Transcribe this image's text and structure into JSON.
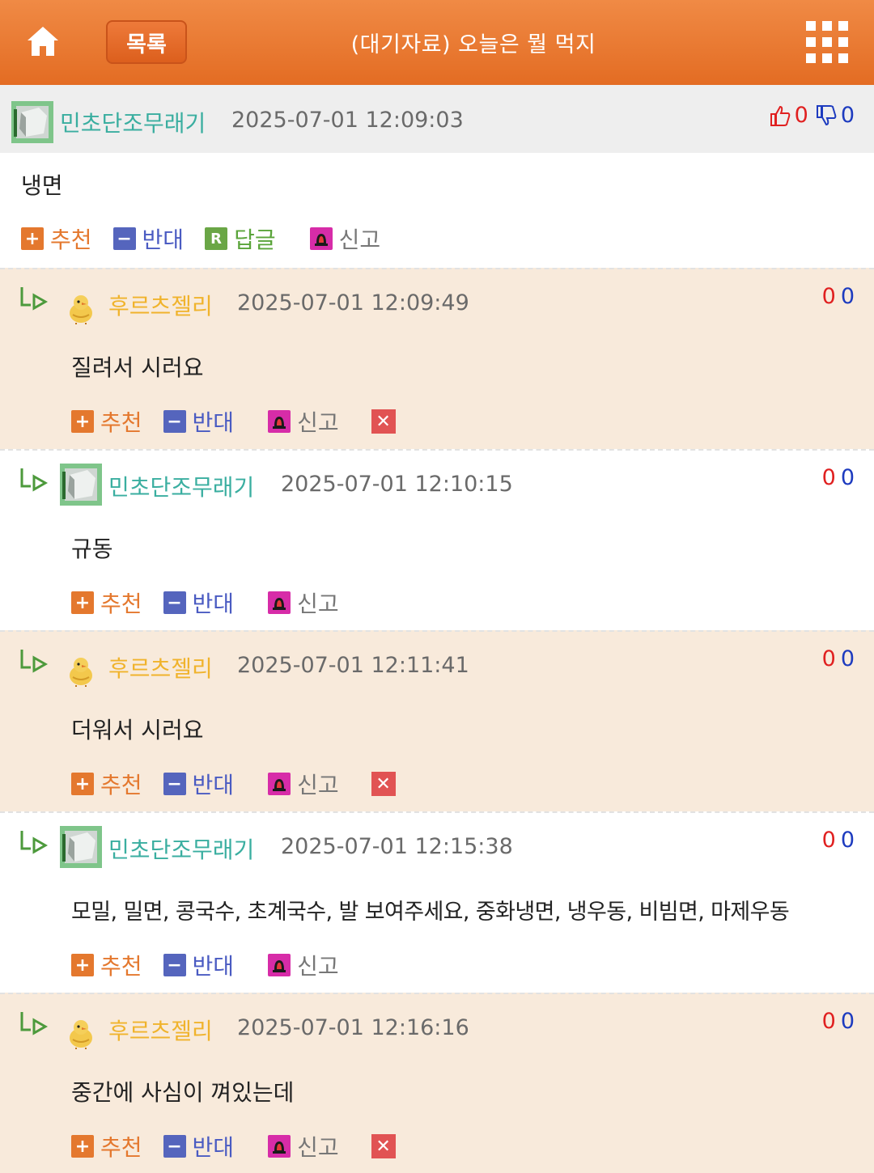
{
  "header": {
    "list_label": "목록",
    "title": "(대기자료) 오늘은 뭘 먹지",
    "home_icon": "home-icon",
    "menu_icon": "grid-menu-icon",
    "bar_color": "#e36c23"
  },
  "actions_labels": {
    "recommend": "추천",
    "oppose": "반대",
    "reply": "답글",
    "report": "신고"
  },
  "comments": [
    {
      "nick": "민초단조무래기",
      "date": "2025-07-01 12:09:03",
      "up": "0",
      "down": "0",
      "text": "냉면"
    },
    {
      "nick": "후르츠젤리",
      "date": "2025-07-01 12:09:49",
      "up": "0",
      "down": "0",
      "text": "질려서 시러요"
    },
    {
      "nick": "민초단조무래기",
      "date": "2025-07-01 12:10:15",
      "up": "0",
      "down": "0",
      "text": "규동"
    },
    {
      "nick": "후르츠젤리",
      "date": "2025-07-01 12:11:41",
      "up": "0",
      "down": "0",
      "text": "더워서 시러요"
    },
    {
      "nick": "민초단조무래기",
      "date": "2025-07-01 12:15:38",
      "up": "0",
      "down": "0",
      "text": "모밀, 밀면, 콩국수, 초계국수, 발 보여주세요, 중화냉면, 냉우동, 비빔면, 마제우동"
    },
    {
      "nick": "후르츠젤리",
      "date": "2025-07-01 12:16:16",
      "up": "0",
      "down": "0",
      "text": "중간에 사심이 껴있는데"
    }
  ]
}
